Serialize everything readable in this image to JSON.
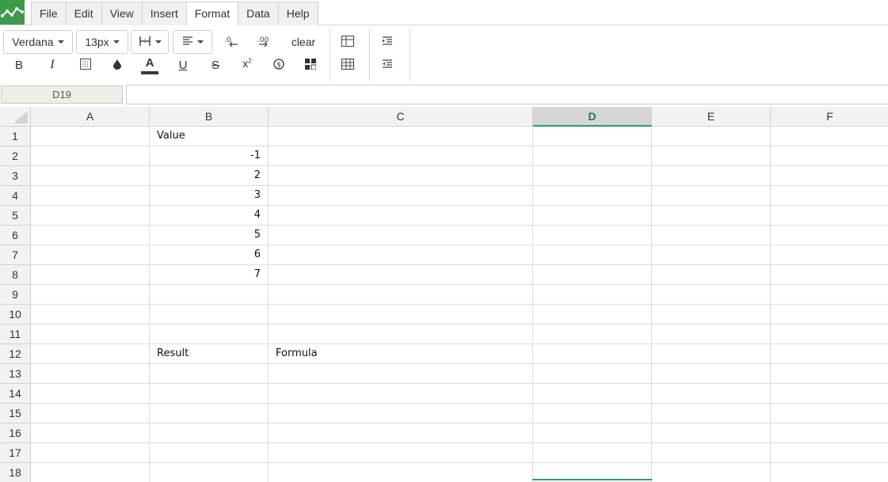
{
  "menubar": {
    "logo_icon": "spreadsheet-logo-icon",
    "items": [
      "File",
      "Edit",
      "View",
      "Insert",
      "Format",
      "Data",
      "Help"
    ],
    "active": "Format"
  },
  "toolbar": {
    "font_family": "Verdana",
    "font_size": "13px",
    "clear_label": "clear",
    "icons": [
      "borders-icon",
      "align-left-icon",
      "decrease-decimals-icon",
      "increase-decimals-icon",
      "bold-icon",
      "italic-icon",
      "cell-background-icon",
      "fill-color-icon",
      "text-color-icon",
      "underline-icon",
      "strikethrough-icon",
      "superscript-icon",
      "currency-icon",
      "number-format-icon",
      "table-icon",
      "grid-table-icon",
      "indent-icon",
      "outdent-icon"
    ]
  },
  "formula_bar": {
    "name_box": "D19",
    "formula": ""
  },
  "grid": {
    "columns": [
      "A",
      "B",
      "C",
      "D",
      "E",
      "F"
    ],
    "selected_column": "D",
    "rows": [
      {
        "n": "1",
        "cells": [
          "",
          "Value",
          "",
          "",
          "",
          ""
        ]
      },
      {
        "n": "2",
        "cells": [
          "",
          "-1",
          "",
          "",
          "",
          ""
        ]
      },
      {
        "n": "3",
        "cells": [
          "",
          "2",
          "",
          "",
          "",
          ""
        ]
      },
      {
        "n": "4",
        "cells": [
          "",
          "3",
          "",
          "",
          "",
          ""
        ]
      },
      {
        "n": "5",
        "cells": [
          "",
          "4",
          "",
          "",
          "",
          ""
        ]
      },
      {
        "n": "6",
        "cells": [
          "",
          "5",
          "",
          "",
          "",
          ""
        ]
      },
      {
        "n": "7",
        "cells": [
          "",
          "6",
          "",
          "",
          "",
          ""
        ]
      },
      {
        "n": "8",
        "cells": [
          "",
          "7",
          "",
          "",
          "",
          ""
        ]
      },
      {
        "n": "9",
        "cells": [
          "",
          "",
          "",
          "",
          "",
          ""
        ]
      },
      {
        "n": "10",
        "cells": [
          "",
          "",
          "",
          "",
          "",
          ""
        ]
      },
      {
        "n": "11",
        "cells": [
          "",
          "",
          "",
          "",
          "",
          ""
        ]
      },
      {
        "n": "12",
        "cells": [
          "",
          "Result",
          "Formula",
          "",
          "",
          ""
        ]
      },
      {
        "n": "13",
        "cells": [
          "",
          "",
          "",
          "",
          "",
          ""
        ]
      },
      {
        "n": "14",
        "cells": [
          "",
          "",
          "",
          "",
          "",
          ""
        ]
      },
      {
        "n": "15",
        "cells": [
          "",
          "",
          "",
          "",
          "",
          ""
        ]
      },
      {
        "n": "16",
        "cells": [
          "",
          "",
          "",
          "",
          "",
          ""
        ]
      },
      {
        "n": "17",
        "cells": [
          "",
          "",
          "",
          "",
          "",
          ""
        ]
      },
      {
        "n": "18",
        "cells": [
          "",
          "",
          "",
          "",
          "",
          ""
        ]
      }
    ]
  },
  "colors": {
    "accent": "#25a06a",
    "logo": "#3c9a4a"
  }
}
